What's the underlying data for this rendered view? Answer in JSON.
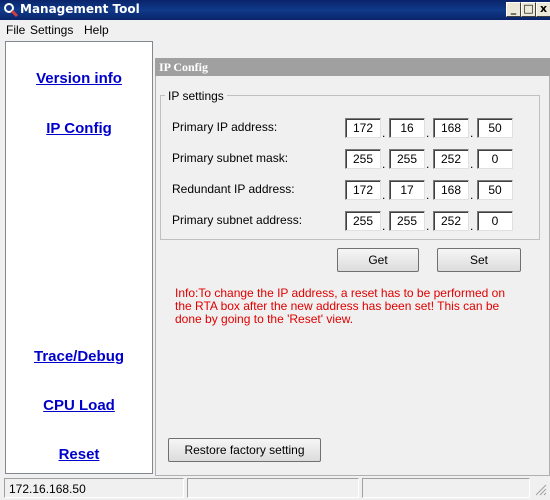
{
  "window": {
    "title": "Management Tool",
    "icon": "wrench-magnifier-icon",
    "controls": {
      "minimize": "_",
      "maximize": "□",
      "close": "x"
    }
  },
  "menu": [
    "File",
    "Settings",
    "Help"
  ],
  "nav": {
    "items": [
      {
        "label": "Version info"
      },
      {
        "label": "IP Config"
      },
      {
        "label": "Trace/Debug"
      },
      {
        "label": "CPU Load"
      },
      {
        "label": "Reset"
      }
    ]
  },
  "panel": {
    "title": "IP Config",
    "group_title": "IP settings",
    "rows": [
      {
        "label": "Primary IP address:",
        "octets": [
          "172",
          "16",
          "168",
          "50"
        ]
      },
      {
        "label": "Primary subnet mask:",
        "octets": [
          "255",
          "255",
          "252",
          "0"
        ]
      },
      {
        "label": "Redundant IP address:",
        "octets": [
          "172",
          "17",
          "168",
          "50"
        ]
      },
      {
        "label": "Primary subnet address:",
        "octets": [
          "255",
          "255",
          "252",
          "0"
        ]
      }
    ],
    "get_label": "Get",
    "set_label": "Set",
    "info": "Info:To change the IP address, a reset has to be performed on the RTA box after the new address has been set! This can be done by going to the 'Reset' view.",
    "restore_label": "Restore factory setting"
  },
  "status": {
    "ip": "172.16.168.50",
    "pane2": "",
    "pane3": ""
  },
  "colors": {
    "link": "#0000cc",
    "info": "#e00000",
    "titlebar": "#0a246a"
  }
}
